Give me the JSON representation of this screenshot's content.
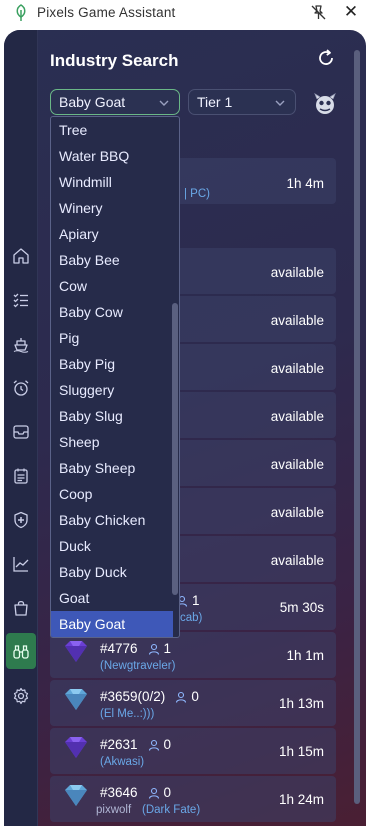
{
  "window": {
    "title": "Pixels Game Assistant",
    "icons": {
      "logo": "leaf-logo",
      "pin": "pin-off-icon",
      "close": "close-icon"
    }
  },
  "header": {
    "title": "Industry Search",
    "refresh_icon": "refresh-icon"
  },
  "filters": {
    "animal_selected": "Baby Goat",
    "tier_selected": "Tier 1"
  },
  "sidebar": {
    "items": [
      {
        "icon": "home-icon"
      },
      {
        "icon": "checklist-icon"
      },
      {
        "icon": "ship-icon"
      },
      {
        "icon": "alarm-clock-icon"
      },
      {
        "icon": "inbox-icon"
      },
      {
        "icon": "calendar-icon"
      },
      {
        "icon": "shield-plus-icon"
      },
      {
        "icon": "trend-chart-icon"
      },
      {
        "icon": "bag-icon"
      },
      {
        "icon": "binoculars-icon",
        "active": true
      },
      {
        "icon": "gear-icon"
      }
    ]
  },
  "dropdown": {
    "options": [
      "Tree",
      "Water BBQ",
      "Windmill",
      "Winery",
      "Apiary",
      "Baby Bee",
      "Cow",
      "Baby Cow",
      "Pig",
      "Baby Pig",
      "Sluggery",
      "Baby Slug",
      "Sheep",
      "Baby Sheep",
      "Coop",
      "Baby Chicken",
      "Duck",
      "Baby Duck",
      "Goat",
      "Baby Goat"
    ],
    "selected_index": 19
  },
  "results": {
    "top_row": {
      "sub": "| PC)",
      "time": "1h 4m"
    },
    "available_rows": [
      "available",
      "available",
      "available",
      "available",
      "available",
      "available",
      "available"
    ],
    "land_rows": [
      {
        "id": "",
        "count": "1",
        "owner": "cab)",
        "time": "5m 30s",
        "gem": "purple"
      },
      {
        "id": "#4776",
        "count": "1",
        "owner": "(Newgtraveler)",
        "time": "1h 1m",
        "gem": "purple"
      },
      {
        "id": "#3659(0/2)",
        "count": "0",
        "owner": "(El Me..:)))",
        "time": "1h 13m",
        "gem": "blue"
      },
      {
        "id": "#2631",
        "count": "0",
        "owner": "(Akwasi)",
        "time": "1h 15m",
        "gem": "purple"
      },
      {
        "id": "#3646",
        "count": "0",
        "owner_prefix": "pixwolf",
        "owner": "(Dark Fate)",
        "time": "1h 24m",
        "gem": "blue"
      }
    ]
  },
  "colors": {
    "accent_green": "#2e7b4e",
    "selected_blue": "#3e58b8",
    "link_blue": "#6aa8e8"
  }
}
